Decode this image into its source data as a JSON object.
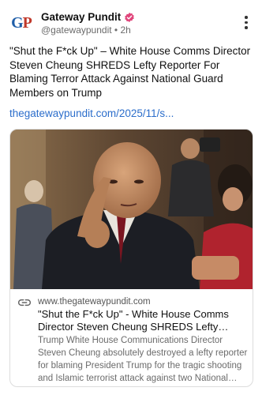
{
  "header": {
    "name": "Gateway Pundit",
    "handle": "@gatewaypundit",
    "separator": "•",
    "timestamp": "2h",
    "avatar_text_g": "G",
    "avatar_text_p": "P",
    "verified_color": "#e0457b"
  },
  "post": {
    "text": "\"Shut the F*ck Up\" – White House Comms Director Steven Cheung SHREDS Lefty Reporter For Blaming Terror Attack Against National Guard Members on Trump",
    "link": "thegatewaypundit.com/2025/11/s..."
  },
  "card": {
    "domain": "www.thegatewaypundit.com",
    "title": "\"Shut the F*ck Up\" - White House Comms Director Steven Cheung SHREDS Lefty Report...",
    "description": "Trump White House Communications Director Steven Cheung absolutely destroyed a lefty reporter for blaming President Trump for the tragic shooting and Islamic terrorist attack against two National Guard me..."
  },
  "colors": {
    "link": "#2c6ecb",
    "accent_blue": "#1f5ea8",
    "accent_red": "#c0392b"
  }
}
